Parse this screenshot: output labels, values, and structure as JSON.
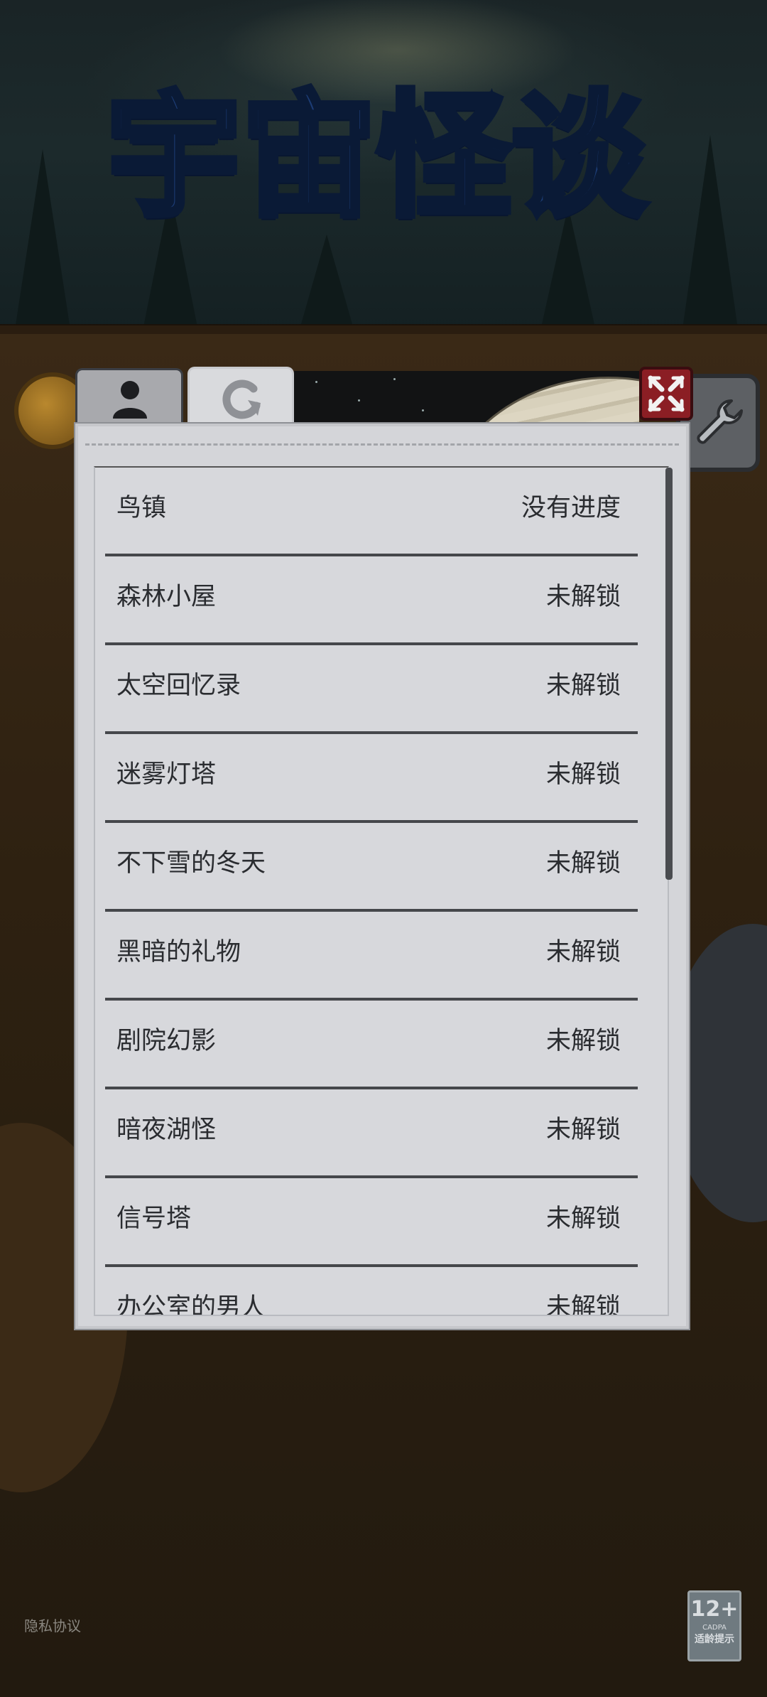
{
  "game": {
    "title_logo": "宇宙怪谈"
  },
  "tabs": [
    {
      "name": "profile",
      "icon": "person-icon"
    },
    {
      "name": "history",
      "icon": "refresh-icon"
    }
  ],
  "levels": [
    {
      "name": "鸟镇",
      "status": "没有进度"
    },
    {
      "name": "森林小屋",
      "status": "未解锁"
    },
    {
      "name": "太空回忆录",
      "status": "未解锁"
    },
    {
      "name": "迷雾灯塔",
      "status": "未解锁"
    },
    {
      "name": "不下雪的冬天",
      "status": "未解锁"
    },
    {
      "name": "黑暗的礼物",
      "status": "未解锁"
    },
    {
      "name": "剧院幻影",
      "status": "未解锁"
    },
    {
      "name": "暗夜湖怪",
      "status": "未解锁"
    },
    {
      "name": "信号塔",
      "status": "未解锁"
    },
    {
      "name": "办公室的男人",
      "status": "未解锁"
    }
  ],
  "footer": {
    "privacy_link": "隐私协议",
    "age_rating": "12+",
    "age_org": "CADPA",
    "age_hint": "适龄提示"
  },
  "colors": {
    "panel": "#d4d5d9",
    "close_button": "#8b1e24",
    "title_logo": "#1c3c74"
  }
}
